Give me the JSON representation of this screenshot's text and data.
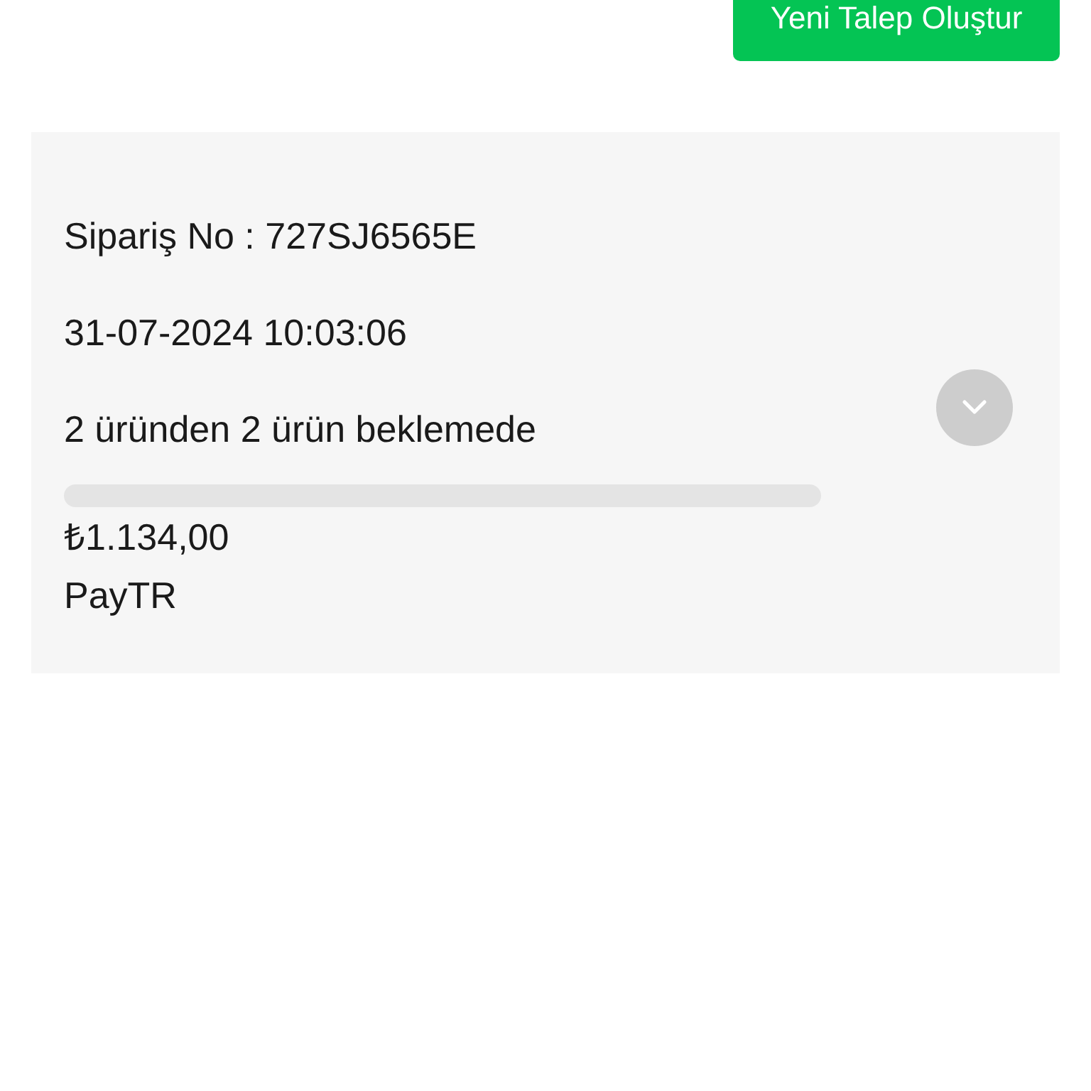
{
  "new_request_button": {
    "label": "Yeni Talep Oluştur"
  },
  "order": {
    "order_number": "Sipariş No : 727SJ6565E",
    "date": "31-07-2024 10:03:06",
    "status": "2 üründen 2 ürün beklemede",
    "progress": {
      "level": 0
    },
    "amount": "₺1.134,00",
    "payment_method": "PayTR",
    "expanded": false
  }
}
